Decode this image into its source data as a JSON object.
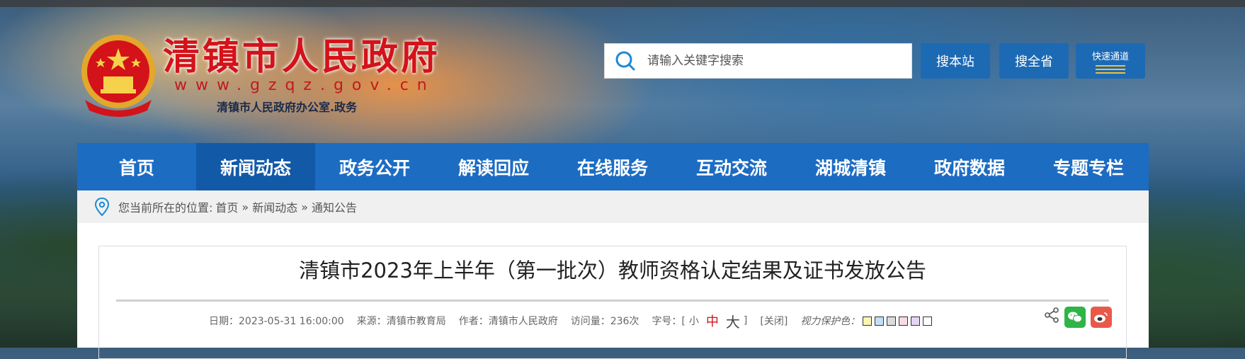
{
  "header": {
    "site_title": "清镇市人民政府",
    "site_url": "www.gzqz.gov.cn",
    "office_line": "清镇市人民政府办公室.政务"
  },
  "search": {
    "placeholder": "请输入关键字搜索",
    "btn_site": "搜本站",
    "btn_province": "搜全省",
    "btn_quick": "快速通道"
  },
  "nav": {
    "items": [
      {
        "label": "首页"
      },
      {
        "label": "新闻动态"
      },
      {
        "label": "政务公开"
      },
      {
        "label": "解读回应"
      },
      {
        "label": "在线服务"
      },
      {
        "label": "互动交流"
      },
      {
        "label": "湖城清镇"
      },
      {
        "label": "政府数据"
      },
      {
        "label": "专题专栏"
      }
    ],
    "active": "新闻动态"
  },
  "breadcrumb": {
    "prefix": "您当前所在的位置:",
    "home": "首页",
    "sep": "»",
    "level1": "新闻动态",
    "level2": "通知公告"
  },
  "article": {
    "title": "清镇市2023年上半年（第一批次）教师资格认定结果及证书发放公告",
    "date": "日期：2023-05-31 16:00:00",
    "source": "来源：清镇市教育局",
    "author": "作者：清镇市人民政府",
    "views": "访问量：236次",
    "fontsize_label": "字号：[",
    "fontsize_small": "小",
    "fontsize_mid": "中",
    "fontsize_big": "大",
    "fontsize_close": "]",
    "close_link": "[关闭]",
    "eye_label": "视力保护色：",
    "swatches": [
      "#fbf5b4",
      "#bfe0f5",
      "#dcdcdc",
      "#f7dbe3",
      "#e7d4f5",
      "#ffffff"
    ]
  },
  "icons": {
    "emblem": "national-emblem-icon",
    "search": "search-icon",
    "location": "location-pin-icon",
    "share": "share-icon",
    "wechat": "wechat-icon",
    "weibo": "weibo-icon"
  }
}
